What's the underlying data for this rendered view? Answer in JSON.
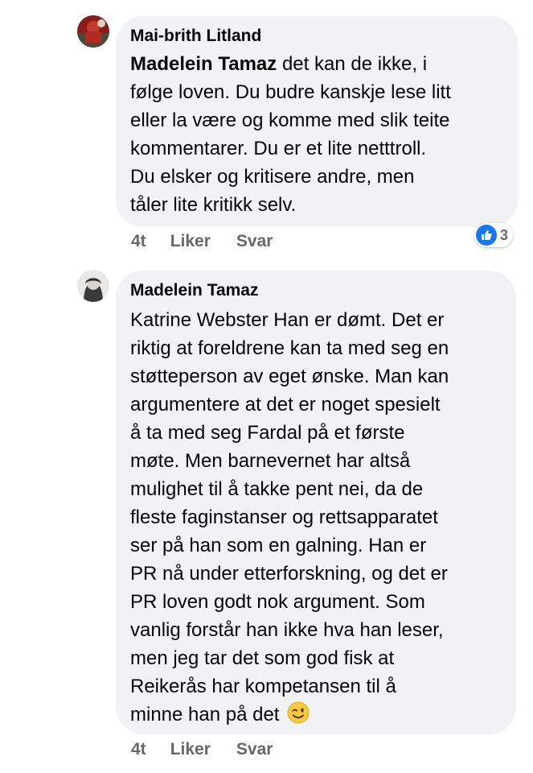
{
  "comments": [
    {
      "author": "Mai-brith Litland",
      "mention": "Madelein Tamaz",
      "lines": [
        " det kan de ikke, i",
        "følge loven. Du budre kanskje lese litt",
        "eller la være og komme med slik teite",
        "kommentarer. Du er et lite netttroll.",
        "Du elsker og kritisere andre, men",
        "tåler lite kritikk selv."
      ],
      "time": "4t",
      "like_label": "Liker",
      "reply_label": "Svar",
      "reaction_icon": "like-icon",
      "reaction_count": "3"
    },
    {
      "author": "Madelein Tamaz",
      "lines": [
        "Katrine Webster Han er dømt. Det er",
        "riktig at foreldrene kan ta med seg en",
        "støtteperson av eget ønske. Man kan",
        "argumentere at det er noget spesielt",
        "å ta med seg Fardal på et første",
        "møte. Men barnevernet har altså",
        "mulighet til å takke pent nei, da de",
        "fleste faginstanser og rettsapparatet",
        "ser på han som en galning. Han er",
        "PR nå under etterforskning, og det er",
        "PR loven godt nok argument. Som",
        "vanlig forstår han ikke hva han leser,",
        "men jeg tar det som god fisk at",
        "Reikerås har kompetansen til å",
        "minne han på det"
      ],
      "trailing_emoji": "winking-face-emoji",
      "time": "4t",
      "like_label": "Liker",
      "reply_label": "Svar"
    }
  ],
  "colors": {
    "bubble": "#f0f2f5",
    "text": "#050505",
    "meta": "#65676b",
    "like_blue": "#1877f2"
  }
}
